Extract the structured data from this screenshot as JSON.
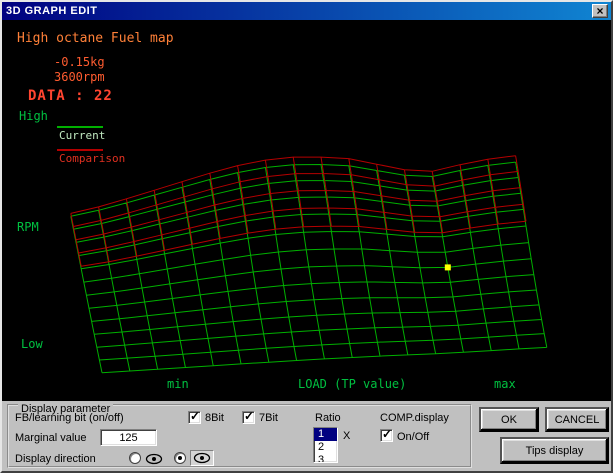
{
  "titlebar": {
    "title": "3D GRAPH EDIT",
    "close": "×"
  },
  "graph": {
    "map_title": "High octane Fuel map",
    "weight": "-0.15kg",
    "rpm": "3600rpm",
    "data": "DATA : 22",
    "y_axis": {
      "high": "High",
      "label": "RPM",
      "low": "Low"
    },
    "x_axis": {
      "min": "min",
      "label": "LOAD (TP value)",
      "max": "max"
    },
    "legend": {
      "current": "Current",
      "comparison": "Comparison"
    },
    "colors": {
      "title": "#ff8038",
      "value": "#ff5c30",
      "data": "#ff4530",
      "axis": "#00c040",
      "legend_current_text": "#c0e8c0",
      "legend_comparison_text": "#e03020"
    },
    "chart_data": {
      "type": "surface-wireframe",
      "title": "High octane Fuel map",
      "xlabel": "LOAD (TP value)",
      "ylabel": "RPM",
      "x_range_labels": [
        "min",
        "max"
      ],
      "y_range_labels": [
        "Low",
        "High"
      ],
      "selected_value_labels": {
        "data": "22",
        "weight": "-0.15kg",
        "rpm": "3600rpm"
      },
      "series": [
        {
          "name": "Current",
          "color": "#00b000"
        },
        {
          "name": "Comparison",
          "color": "#b40000"
        }
      ],
      "cols": 16,
      "rows": 12,
      "origin": [
        100,
        353
      ],
      "du": [
        27.8,
        -1.5
      ],
      "dv": [
        -2.6,
        -12.5
      ],
      "lift": [
        2,
        3.5,
        5.5,
        8,
        11,
        14.5,
        18.5,
        23,
        28,
        33,
        37.5,
        41.5,
        45
      ],
      "shape": [
        0.15,
        0.25,
        0.38,
        0.52,
        0.66,
        0.8,
        0.92,
        1.0,
        1.03,
        1.0,
        0.94,
        0.8,
        0.66,
        0.6,
        0.7,
        0.78,
        0.82
      ],
      "comparison_scale": 1.12,
      "comparison_offset": 2,
      "comparison_rows_from": 8,
      "selected_cell": {
        "u": 13,
        "v": 6
      },
      "selected_color": "#ffff00"
    }
  },
  "panel": {
    "group_label": "Display parameter",
    "fb_label": "FB/learning bit (on/off)",
    "bit8_label": "8Bit",
    "bit8_checked": true,
    "bit7_label": "7Bit",
    "bit7_checked": true,
    "marginal_label": "Marginal value",
    "marginal_value": "125",
    "direction_label": "Display direction",
    "direction_selected": 1,
    "ratio_label": "Ratio",
    "ratio_options": [
      "1",
      "2",
      "3"
    ],
    "ratio_selected": "1",
    "ratio_multiply": "X",
    "comp_label": "COMP.display",
    "onoff_label": "On/Off",
    "onoff_checked": true,
    "ok_label": "OK",
    "cancel_label": "CANCEL",
    "tips_label": "Tips display"
  }
}
